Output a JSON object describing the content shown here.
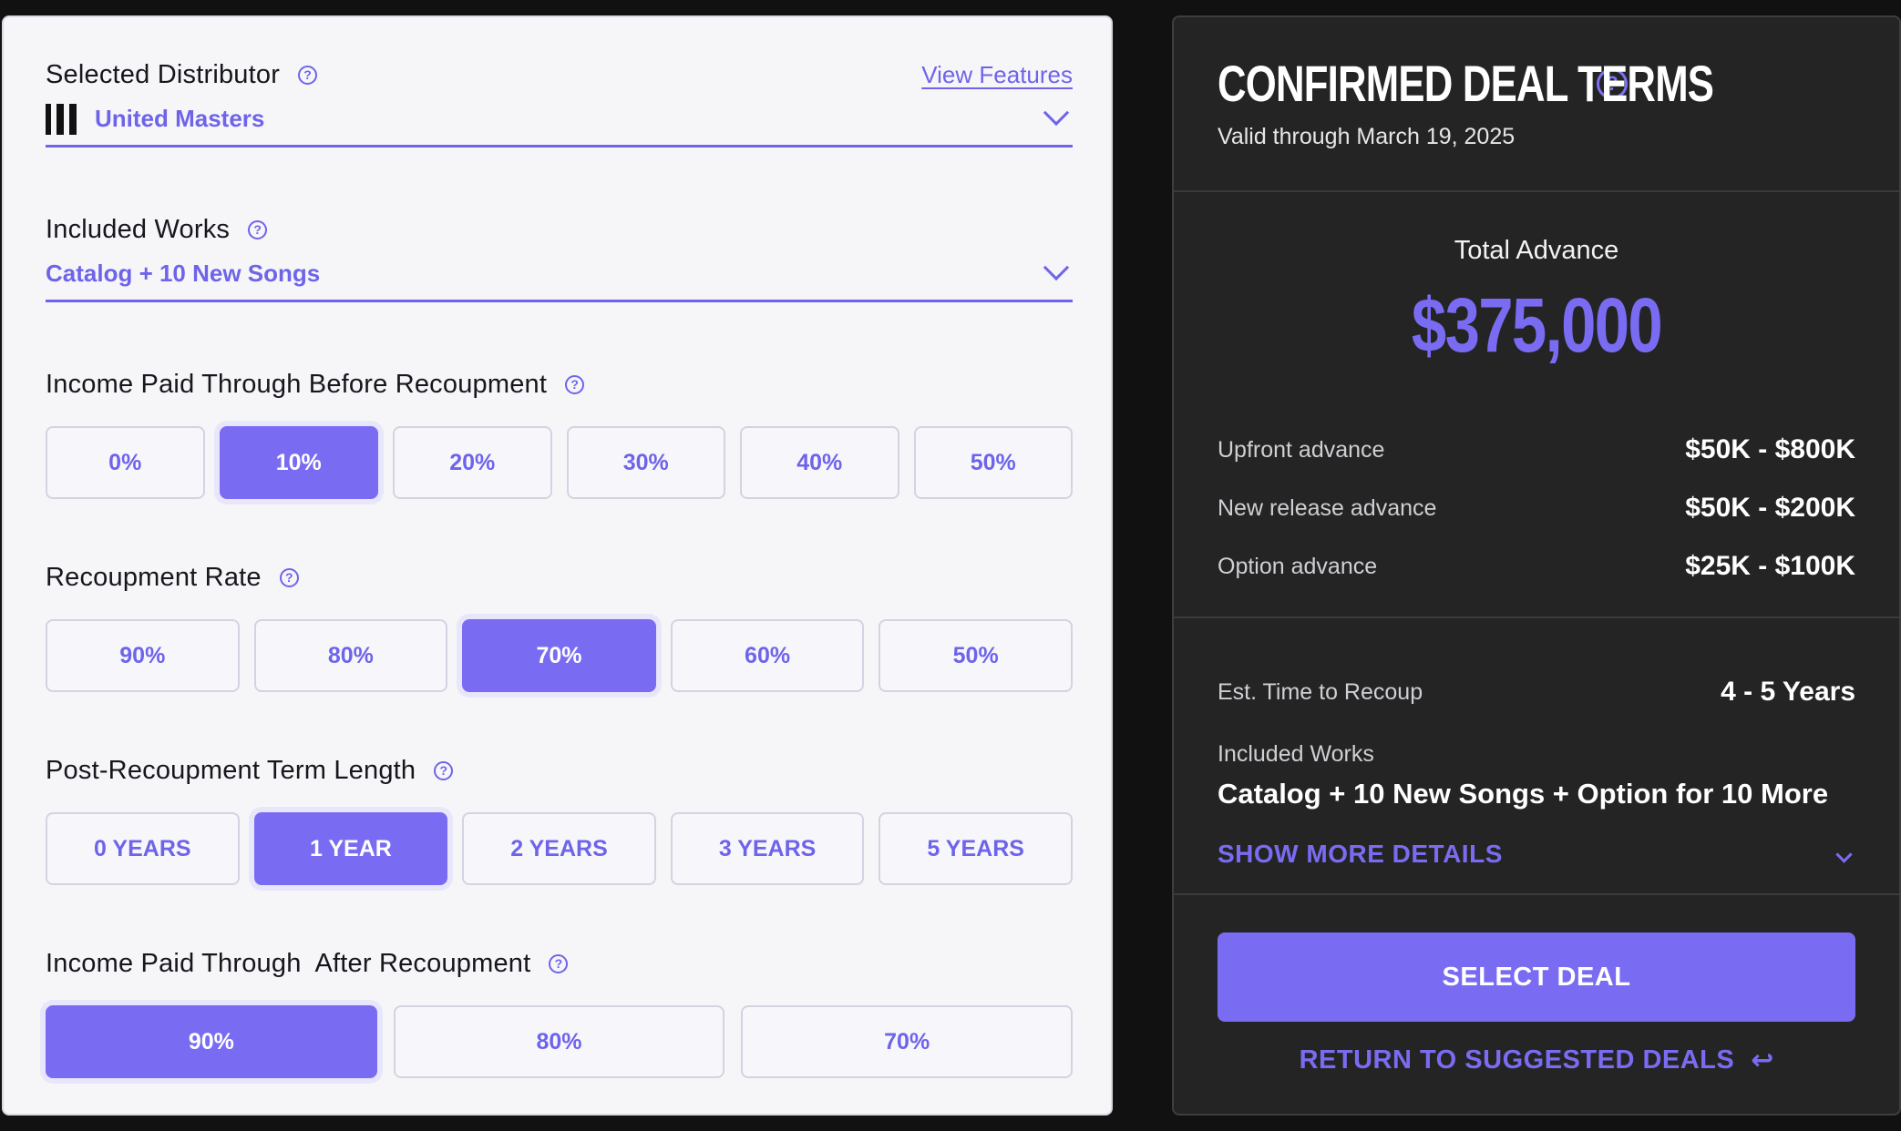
{
  "left": {
    "distributor": {
      "label": "Selected Distributor",
      "view_features": "View Features",
      "value": "United Masters"
    },
    "included_works": {
      "label": "Included Works",
      "value": "Catalog + 10 New Songs"
    },
    "income_before": {
      "label": "Income Paid Through Before Recoupment",
      "options": [
        "0%",
        "10%",
        "20%",
        "30%",
        "40%",
        "50%"
      ],
      "selected": "10%"
    },
    "recoupment_rate": {
      "label": "Recoupment Rate",
      "options": [
        "90%",
        "80%",
        "70%",
        "60%",
        "50%"
      ],
      "selected": "70%"
    },
    "term_length": {
      "label": "Post-Recoupment Term Length",
      "options": [
        "0 YEARS",
        "1 YEAR",
        "2 YEARS",
        "3 YEARS",
        "5 YEARS"
      ],
      "selected": "1 YEAR"
    },
    "income_after": {
      "label": "Income Paid Through  After Recoupment",
      "options": [
        "90%",
        "80%",
        "70%"
      ],
      "selected": "90%"
    }
  },
  "right": {
    "title": "CONFIRMED DEAL TERMS",
    "valid_through": "Valid through March 19, 2025",
    "total_label": "Total Advance",
    "total_value": "$375,000",
    "advances": [
      {
        "label": "Upfront advance",
        "value": "$50K - $800K"
      },
      {
        "label": "New release advance",
        "value": "$50K - $200K"
      },
      {
        "label": "Option advance",
        "value": "$25K - $100K"
      }
    ],
    "recoup": {
      "label": "Est. Time to Recoup",
      "value": "4 - 5 Years"
    },
    "included_works_label": "Included Works",
    "included_works_value": "Catalog + 10 New Songs + Option for 10 More",
    "show_more": "SHOW MORE DETAILS",
    "select_deal": "SELECT DEAL",
    "return_link": "RETURN TO SUGGESTED DEALS"
  },
  "icons": {
    "help": "question-circle-icon",
    "chevron": "chevron-down-icon",
    "return": "return-arrow-icon",
    "logo": "united-masters-logo"
  },
  "colors": {
    "accent": "#7a6cf2",
    "left_bg": "#f6f6f9",
    "right_bg": "#242424"
  }
}
